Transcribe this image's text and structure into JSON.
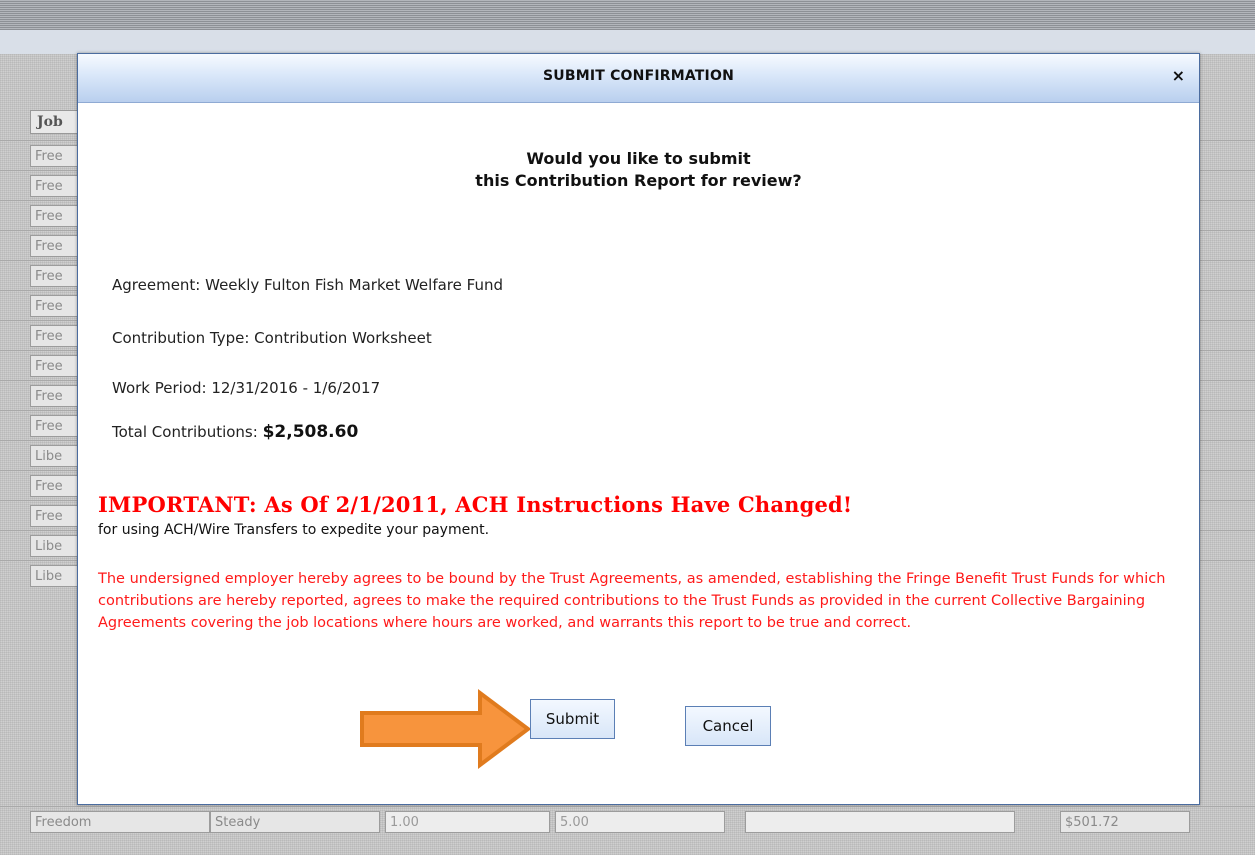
{
  "dialog": {
    "title": "SUBMIT CONFIRMATION",
    "close_label": "×",
    "question_line1": "Would you like to submit",
    "question_line2": "this Contribution Report for review?",
    "agreement": "Agreement: Weekly Fulton Fish Market Welfare Fund",
    "contribution_type": "Contribution Type: Contribution Worksheet",
    "work_period": "Work Period: 12/31/2016 - 1/6/2017",
    "total_label": "Total Contributions: ",
    "total_value": "$2,508.60",
    "important_heading": "IMPORTANT: As Of 2/1/2011, ACH Instructions Have Changed!",
    "important_sub": "for using ACH/Wire Transfers to expedite your payment.",
    "legal_text": "The undersigned employer hereby agrees to be bound by the Trust Agreements, as amended, establishing the Fringe Benefit Trust Funds for which contributions are hereby reported, agrees to make the required contributions to the Trust Funds as provided in the current Collective Bargaining Agreements covering the job locations where hours are worked, and warrants this report to be true and correct.",
    "submit_label": "Submit",
    "cancel_label": "Cancel"
  },
  "background": {
    "header_label": "Job",
    "row_labels": [
      "Free",
      "Free",
      "Free",
      "Free",
      "Free",
      "Free",
      "Free",
      "Free",
      "Free",
      "Free",
      "Libe",
      "Free",
      "Free",
      "Libe",
      "Libe"
    ],
    "last_row": {
      "col1": "Freedom",
      "col2": "Steady",
      "col3": "1.00",
      "col4": "5.00",
      "col5": "",
      "col6": "$501.72"
    }
  },
  "colors": {
    "title_gradient_top": "#f7faff",
    "title_gradient_bottom": "#b9cfee",
    "warning_red": "#ff0000",
    "arrow_orange": "#f7943d",
    "arrow_outline": "#e07b1e"
  },
  "icons": {
    "arrow": "right-pointing-arrow",
    "close": "close-icon"
  }
}
